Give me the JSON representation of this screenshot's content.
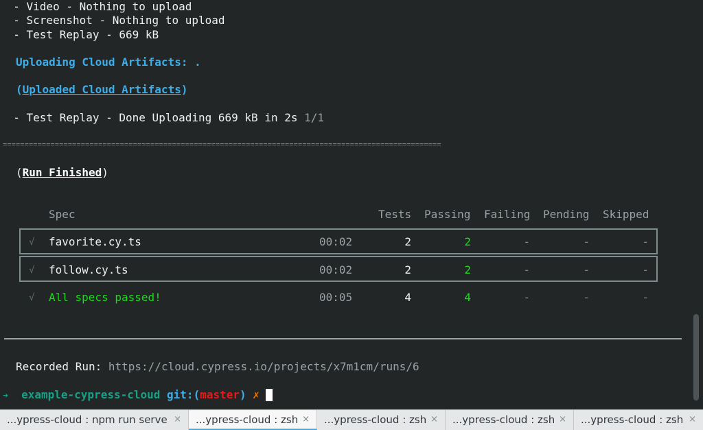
{
  "terminal": {
    "upload_lines": [
      "  - Video - Nothing to upload",
      "  - Screenshot - Nothing to upload",
      "  - Test Replay - 669 kB"
    ],
    "uploading_label": "Uploading Cloud Artifacts: .",
    "uploaded_label": "Uploaded Cloud Artifacts",
    "done_line": "  - Test Replay - Done Uploading 669 kB in 2s",
    "done_count": "1/1",
    "separator": "=====================================================================================================",
    "run_finished_label": "Run Finished",
    "table": {
      "headers": {
        "spec": "Spec",
        "tests": "Tests",
        "passing": "Passing",
        "failing": "Failing",
        "pending": "Pending",
        "skipped": "Skipped"
      },
      "rows": [
        {
          "check": "√",
          "spec": "favorite.cy.ts",
          "duration": "00:02",
          "tests": "2",
          "passing": "2",
          "failing": "-",
          "pending": "-",
          "skipped": "-"
        },
        {
          "check": "√",
          "spec": "follow.cy.ts",
          "duration": "00:02",
          "tests": "2",
          "passing": "2",
          "failing": "-",
          "pending": "-",
          "skipped": "-"
        }
      ],
      "summary": {
        "check": "√",
        "spec": "All specs passed!",
        "duration": "00:05",
        "tests": "4",
        "passing": "4",
        "failing": "-",
        "pending": "-",
        "skipped": "-"
      }
    },
    "recorded_label": "Recorded Run:",
    "recorded_url": "https://cloud.cypress.io/projects/x7m1cm/runs/6",
    "prompt": {
      "arrow": "➜",
      "dir": "example-cypress-cloud",
      "git_prefix": "git:(",
      "branch": "master",
      "git_suffix": ")",
      "dirty": "✗"
    }
  },
  "tabs": [
    {
      "label": "...ypress-cloud : npm run serve",
      "active": false
    },
    {
      "label": "...ypress-cloud : zsh",
      "active": true
    },
    {
      "label": "...ypress-cloud : zsh",
      "active": false
    },
    {
      "label": "...ypress-cloud : zsh",
      "active": false
    },
    {
      "label": "...ypress-cloud : zsh",
      "active": false
    }
  ],
  "tab_close": "×",
  "colors": {
    "background": "#232627",
    "accent": "#3daee9",
    "pass": "#1cdc1c"
  }
}
